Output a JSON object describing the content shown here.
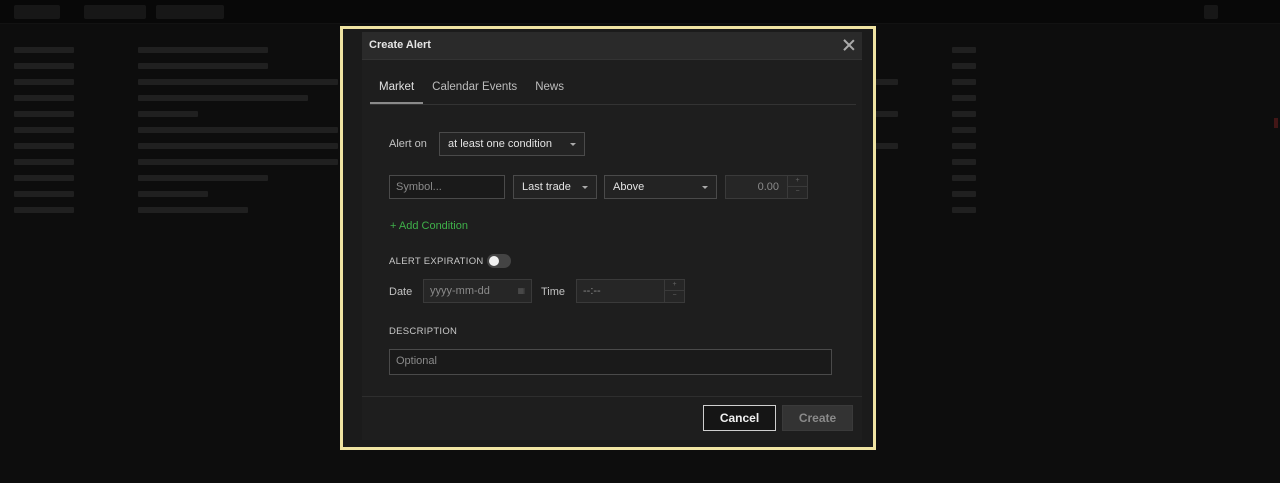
{
  "dialog": {
    "title": "Create Alert",
    "tabs": [
      {
        "label": "Market",
        "active": true
      },
      {
        "label": "Calendar Events",
        "active": false
      },
      {
        "label": "News",
        "active": false
      }
    ],
    "alert_on": {
      "label": "Alert on",
      "value": "at least one condition"
    },
    "condition": {
      "symbol_placeholder": "Symbol...",
      "field_value": "Last trade",
      "operator_value": "Above",
      "threshold_value": "0.00"
    },
    "add_condition": "+ Add Condition",
    "expiration": {
      "label": "ALERT EXPIRATION",
      "enabled": false,
      "date_label": "Date",
      "date_placeholder": "yyyy-mm-dd",
      "time_label": "Time",
      "time_placeholder": "--:--"
    },
    "description": {
      "label": "DESCRIPTION",
      "placeholder": "Optional"
    },
    "buttons": {
      "cancel": "Cancel",
      "create": "Create"
    }
  },
  "colors": {
    "highlight_frame": "#efe3a2",
    "add_condition": "#3fb04a",
    "dialog_bg": "#1e1e1e"
  }
}
